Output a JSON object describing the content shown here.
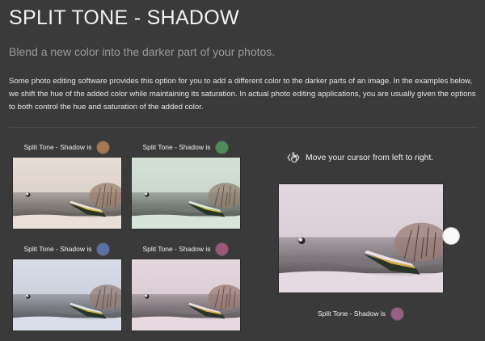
{
  "header": {
    "title": "SPLIT TONE - SHADOW",
    "subtitle": "Blend a new color into the darker part of your photos."
  },
  "description": "Some photo editing software provides this option for you to add a different color to the darker parts of an image. In the examples below, we shift the hue of the added color while maintaining its saturation. In actual photo editing applications, you are usually given the options to both control the hue and saturation of the added color.",
  "examples": [
    {
      "label": "Split Tone - Shadow is",
      "color": "#a8774f"
    },
    {
      "label": "Split Tone - Shadow is",
      "color": "#4f8e58"
    },
    {
      "label": "Split Tone - Shadow is",
      "color": "#5a70a8"
    },
    {
      "label": "Split Tone - Shadow is",
      "color": "#a0567b"
    }
  ],
  "interactive": {
    "hint": "Move your cursor from left to right.",
    "icon": "cursor-left-right-icon",
    "label": "Split Tone - Shadow is",
    "color": "#9a5e85"
  }
}
